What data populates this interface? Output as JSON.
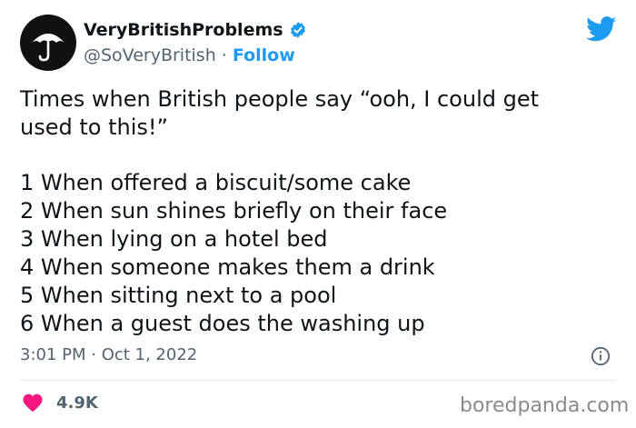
{
  "author": {
    "display_name": "VeryBritishProblems",
    "handle": "@SoVeryBritish",
    "separator": "·",
    "follow_label": "Follow"
  },
  "tweet": {
    "line1": "Times when British people say “ooh, I could get",
    "line2": "used to this!”",
    "items": [
      "1 When offered a biscuit/some cake",
      "2 When sun shines briefly on their face",
      "3 When lying on a hotel bed",
      "4 When someone makes them a drink",
      "5 When sitting next to a pool",
      "6 When a guest does the washing up"
    ],
    "timestamp": "3:01 PM · Oct 1, 2022"
  },
  "engagement": {
    "likes": "4.9K"
  },
  "watermark": "boredpanda.com",
  "colors": {
    "accent": "#1d9bf0",
    "like": "#f91880",
    "muted": "#536471"
  },
  "icons": [
    "umbrella-icon",
    "verified-badge-icon",
    "twitter-bird-icon",
    "info-icon",
    "heart-icon"
  ]
}
